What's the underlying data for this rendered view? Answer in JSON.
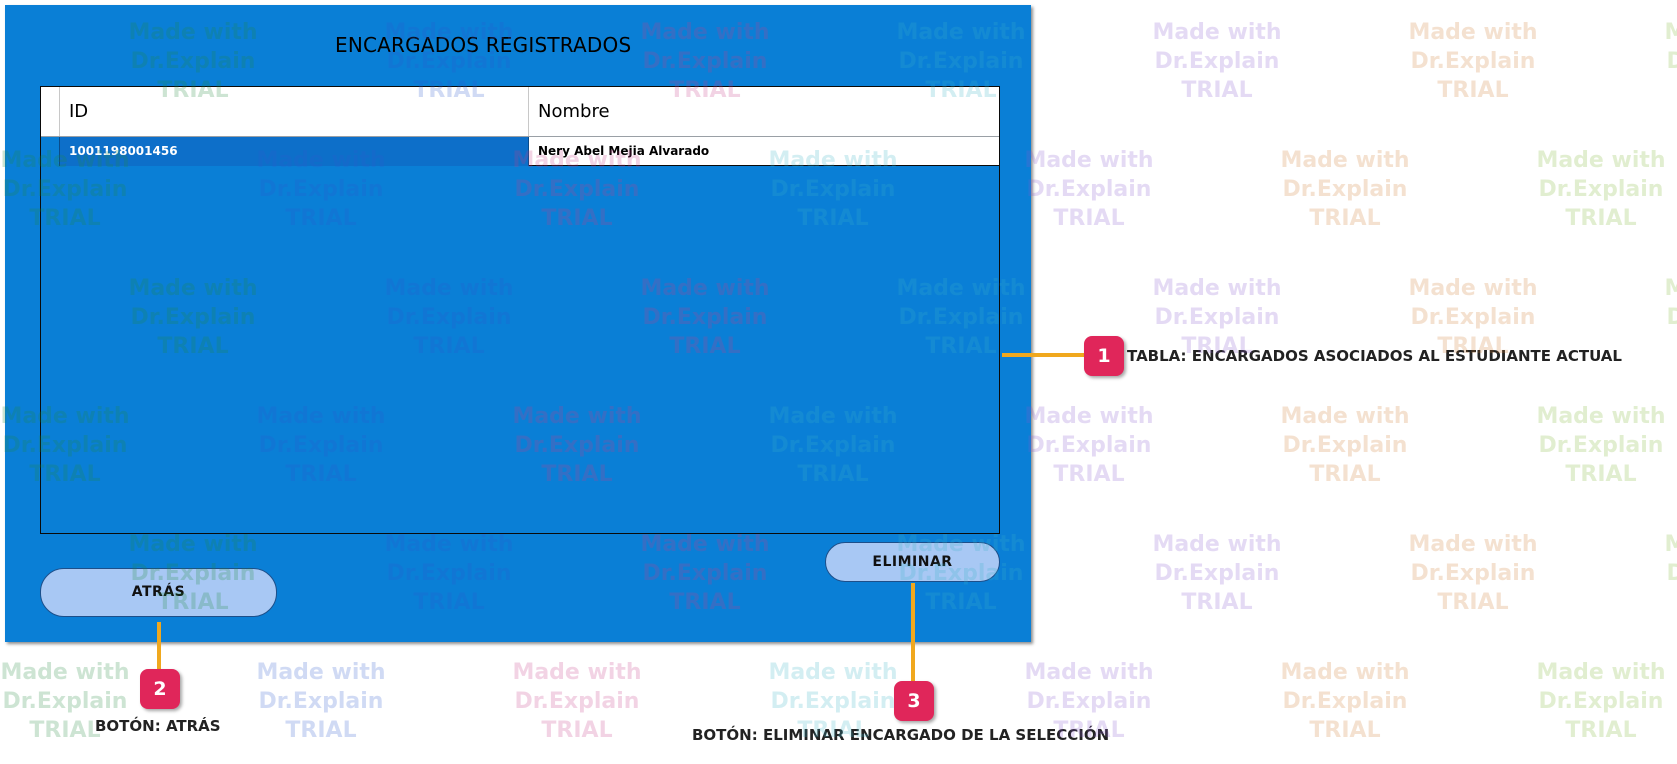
{
  "window": {
    "title": "ENCARGADOS REGISTRADOS"
  },
  "table": {
    "columns": [
      "ID",
      "Nombre"
    ],
    "rows": [
      {
        "id": "1001198001456",
        "nombre": "Nery Abel Mejia Alvarado"
      }
    ]
  },
  "buttons": {
    "back_label": "ATRÁS",
    "delete_label": "ELIMINAR"
  },
  "callouts": [
    {
      "number": "1",
      "text": "TABLA: ENCARGADOS ASOCIADOS AL ESTUDIANTE ACTUAL"
    },
    {
      "number": "2",
      "text": "BOTÓN: ATRÁS"
    },
    {
      "number": "3",
      "text": "BOTÓN: ELIMINAR ENCARGADO DE LA SELECCIÓN"
    }
  ],
  "watermark": {
    "line1": "Made with",
    "line2": "Dr.Explain",
    "line3": "TRIAL"
  },
  "colors": {
    "window_bg": "#0a7fd6",
    "selected_cell": "#0d6fc9",
    "button_bg": "#a8c8f4",
    "callout_line": "#f0a81e",
    "badge": "#e0265a"
  }
}
